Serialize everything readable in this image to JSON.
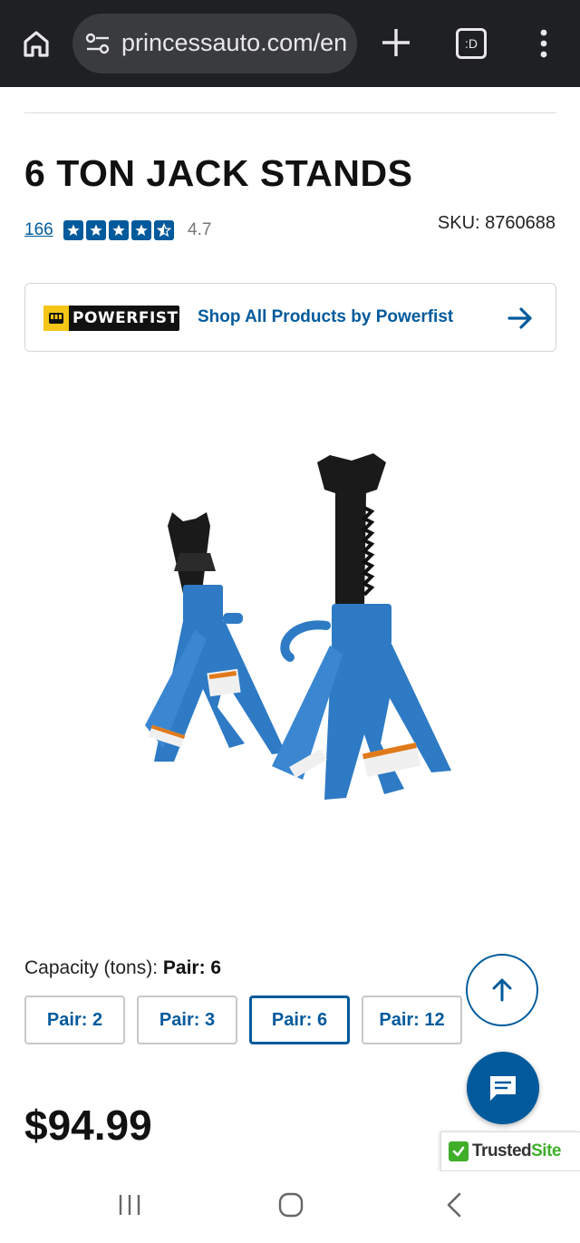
{
  "browser": {
    "url": "princessauto.com/en",
    "tabs_label": ":D"
  },
  "product": {
    "title": "6 TON JACK STANDS",
    "review_count": "166",
    "rating": 4.7,
    "rating_text": "4.7",
    "sku_text": "SKU: 8760688",
    "image_alt": "6 ton jack stands"
  },
  "brand": {
    "logo_text": "POWERFIST",
    "link_text": "Shop All Products by Powerfist"
  },
  "capacity": {
    "label": "Capacity (tons):",
    "selected_value": "Pair: 6",
    "options": [
      "Pair: 2",
      "Pair: 3",
      "Pair: 6",
      "Pair: 12"
    ]
  },
  "price": "$94.99",
  "badges": {
    "trusted_prefix": "Trusted",
    "trusted_suffix": "Site"
  },
  "colors": {
    "accent": "#005a9c",
    "browser_bar": "#1f2023",
    "trusted_green": "#3fae29",
    "brand_yellow": "#f5c518"
  },
  "icons": {
    "home": "home-icon",
    "site_settings": "tune-icon",
    "new_tab": "plus-icon",
    "tabs": "tabs-icon",
    "menu": "more-vert-icon",
    "brand_arrow": "arrow-right-icon",
    "scroll_top": "arrow-up-icon",
    "chat": "chat-icon",
    "nav_recent": "recent-apps-icon",
    "nav_home": "home-circle-icon",
    "nav_back": "back-chevron-icon"
  }
}
